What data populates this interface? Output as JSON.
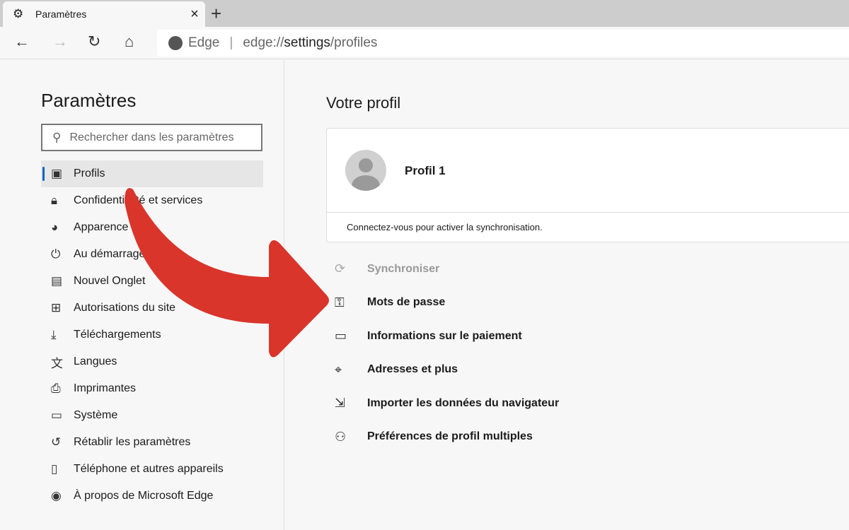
{
  "tab": {
    "icon": "gear-icon",
    "title": "Paramètres",
    "close": "×",
    "new_tab": "+"
  },
  "toolbar": {
    "back": "←",
    "forward": "→",
    "refresh": "↻",
    "home": "⌂",
    "brand": "Edge",
    "separator": "|",
    "url_prefix": "edge://",
    "url_bold": "settings",
    "url_suffix": "/profiles"
  },
  "sidebar": {
    "title": "Paramètres",
    "search_placeholder": "Rechercher dans les paramètres",
    "items": [
      {
        "icon": "profile-icon",
        "glyph": "▣",
        "label": "Profils",
        "active": true
      },
      {
        "icon": "lock-icon",
        "glyph": "🔒︎",
        "label": "Confidentialité et services"
      },
      {
        "icon": "palette-icon",
        "glyph": "◕",
        "label": "Apparence"
      },
      {
        "icon": "power-icon",
        "glyph": "⏻",
        "label": "Au démarrage"
      },
      {
        "icon": "new-tab-icon",
        "glyph": "▤",
        "label": "Nouvel Onglet"
      },
      {
        "icon": "site-permissions-icon",
        "glyph": "⊞",
        "label": "Autorisations du site"
      },
      {
        "icon": "download-icon",
        "glyph": "⤓",
        "label": "Téléchargements"
      },
      {
        "icon": "languages-icon",
        "glyph": "文",
        "label": "Langues"
      },
      {
        "icon": "printer-icon",
        "glyph": "⎙",
        "label": "Imprimantes"
      },
      {
        "icon": "laptop-icon",
        "glyph": "▭",
        "label": "Système"
      },
      {
        "icon": "reset-icon",
        "glyph": "↺",
        "label": "Rétablir les paramètres"
      },
      {
        "icon": "phone-icon",
        "glyph": "▯",
        "label": "Téléphone et autres appareils"
      },
      {
        "icon": "edge-icon",
        "glyph": "◉",
        "label": "À propos de Microsoft Edge"
      }
    ]
  },
  "main": {
    "title": "Votre profil",
    "profile_name": "Profil 1",
    "sync_message": "Connectez-vous pour activer la synchronisation.",
    "items": [
      {
        "icon": "sync-icon",
        "glyph": "⟳",
        "label": "Synchroniser",
        "disabled": true
      },
      {
        "icon": "key-icon",
        "glyph": "⚿",
        "label": "Mots de passe"
      },
      {
        "icon": "card-icon",
        "glyph": "▭",
        "label": "Informations sur le paiement"
      },
      {
        "icon": "location-icon",
        "glyph": "⌖",
        "label": "Adresses et plus"
      },
      {
        "icon": "import-icon",
        "glyph": "⇲",
        "label": "Importer les données du navigateur"
      },
      {
        "icon": "multi-profile-icon",
        "glyph": "⚇",
        "label": "Préférences de profil multiples"
      }
    ]
  },
  "colors": {
    "accent": "#0067c0",
    "arrow": "#d9352b"
  }
}
